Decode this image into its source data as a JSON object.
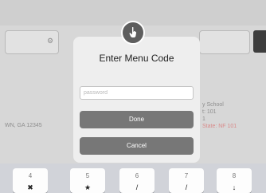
{
  "background": {
    "address": "WN, GA 12345",
    "school_line1": "y School",
    "school_line2": "t: 101",
    "school_line3": "1",
    "school_line4": "State: NF 101"
  },
  "modal": {
    "icon": "hand-pointer-icon",
    "title": "Enter Menu  Code",
    "password_placeholder": "password",
    "password_value": "",
    "done_label": "Done",
    "cancel_label": "Cancel"
  },
  "keyboard": {
    "keys": [
      {
        "num": "4",
        "sym": "✖"
      },
      {
        "num": "5",
        "sym": "★"
      },
      {
        "num": "6",
        "sym": "/"
      },
      {
        "num": "7",
        "sym": "/"
      },
      {
        "num": "8",
        "sym": "↓"
      }
    ]
  },
  "colors": {
    "modal_bg": "#eeeeee",
    "button_bg": "#777777",
    "icon_bg": "#5e5e5e",
    "overlay": "#d7d7d7"
  }
}
